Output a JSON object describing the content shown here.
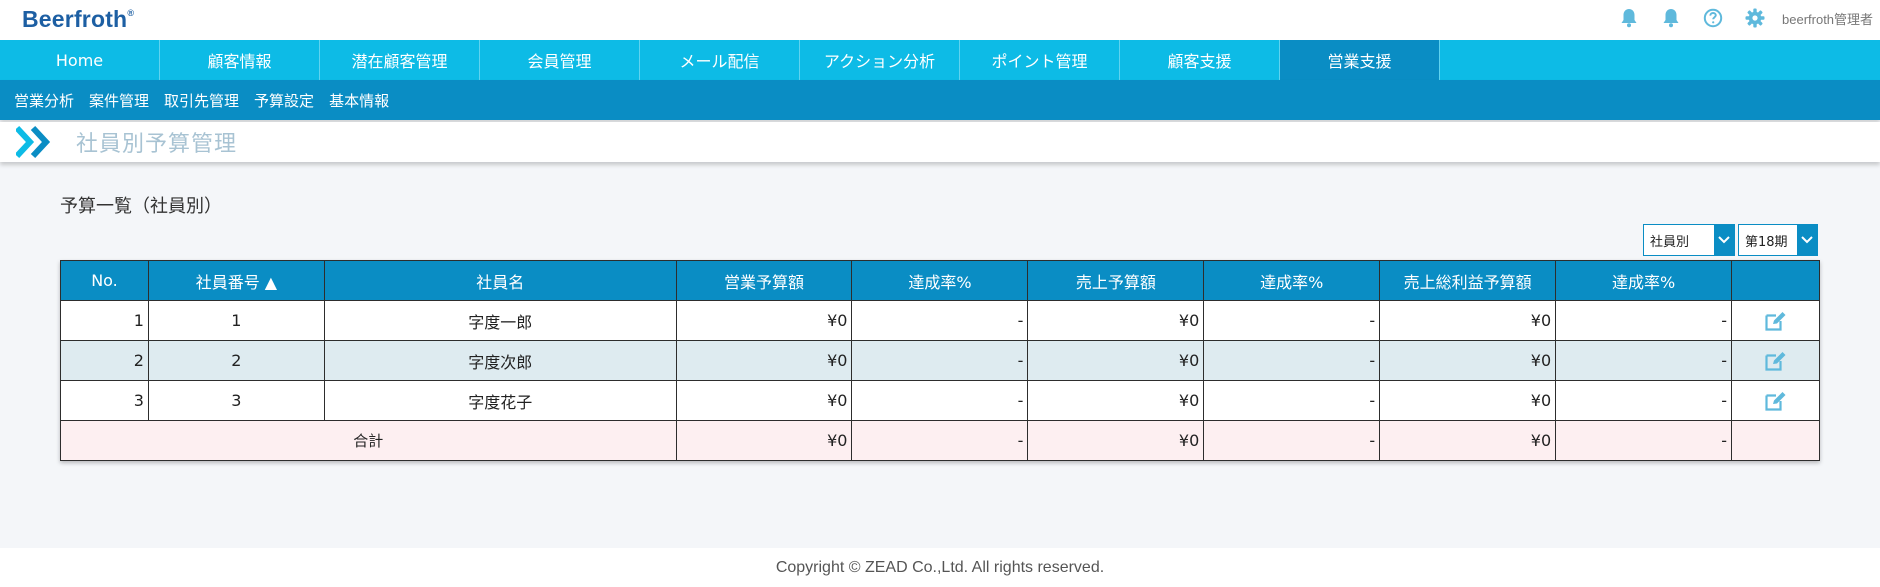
{
  "header": {
    "logo_text": "Beerfroth",
    "logo_mark": "®",
    "user_name": "beerfroth管理者",
    "icons": [
      "bell-icon",
      "bell-icon",
      "help-icon",
      "gear-icon"
    ]
  },
  "main_nav": {
    "items": [
      {
        "label": "Home"
      },
      {
        "label": "顧客情報"
      },
      {
        "label": "潜在顧客管理"
      },
      {
        "label": "会員管理"
      },
      {
        "label": "メール配信"
      },
      {
        "label": "アクション分析"
      },
      {
        "label": "ポイント管理"
      },
      {
        "label": "顧客支援"
      },
      {
        "label": "営業支援"
      }
    ],
    "active_index": 8
  },
  "sub_nav": {
    "items": [
      {
        "label": "営業分析"
      },
      {
        "label": "案件管理"
      },
      {
        "label": "取引先管理"
      },
      {
        "label": "予算設定"
      },
      {
        "label": "基本情報"
      }
    ]
  },
  "page": {
    "title": "社員別予算管理",
    "section_title": "予算一覧（社員別）"
  },
  "filters": {
    "view_select": "社員別",
    "period_select": "第18期"
  },
  "table": {
    "headers": [
      "No.",
      "社員番号 ▲",
      "社員名",
      "営業予算額",
      "達成率%",
      "売上予算額",
      "達成率%",
      "売上総利益予算額",
      "達成率%",
      ""
    ],
    "rows": [
      {
        "no": "1",
        "emp_no": "1",
        "name": "字度一郎",
        "sales_budget": "¥0",
        "sales_rate": "-",
        "revenue_budget": "¥0",
        "revenue_rate": "-",
        "profit_budget": "¥0",
        "profit_rate": "-"
      },
      {
        "no": "2",
        "emp_no": "2",
        "name": "字度次郎",
        "sales_budget": "¥0",
        "sales_rate": "-",
        "revenue_budget": "¥0",
        "revenue_rate": "-",
        "profit_budget": "¥0",
        "profit_rate": "-"
      },
      {
        "no": "3",
        "emp_no": "3",
        "name": "字度花子",
        "sales_budget": "¥0",
        "sales_rate": "-",
        "revenue_budget": "¥0",
        "revenue_rate": "-",
        "profit_budget": "¥0",
        "profit_rate": "-"
      }
    ],
    "total": {
      "label": "合計",
      "sales_budget": "¥0",
      "sales_rate": "-",
      "revenue_budget": "¥0",
      "revenue_rate": "-",
      "profit_budget": "¥0",
      "profit_rate": "-"
    }
  },
  "footer": {
    "copyright": "Copyright © ZEAD Co.,Ltd. All rights reserved."
  },
  "colors": {
    "nav": "#0dbbe6",
    "nav_active": "#0a8dc4",
    "subnav": "#0a8dc4",
    "row_alt": "#deebf0",
    "row_total": "#fdeff1",
    "logo": "#1d5fa3"
  }
}
